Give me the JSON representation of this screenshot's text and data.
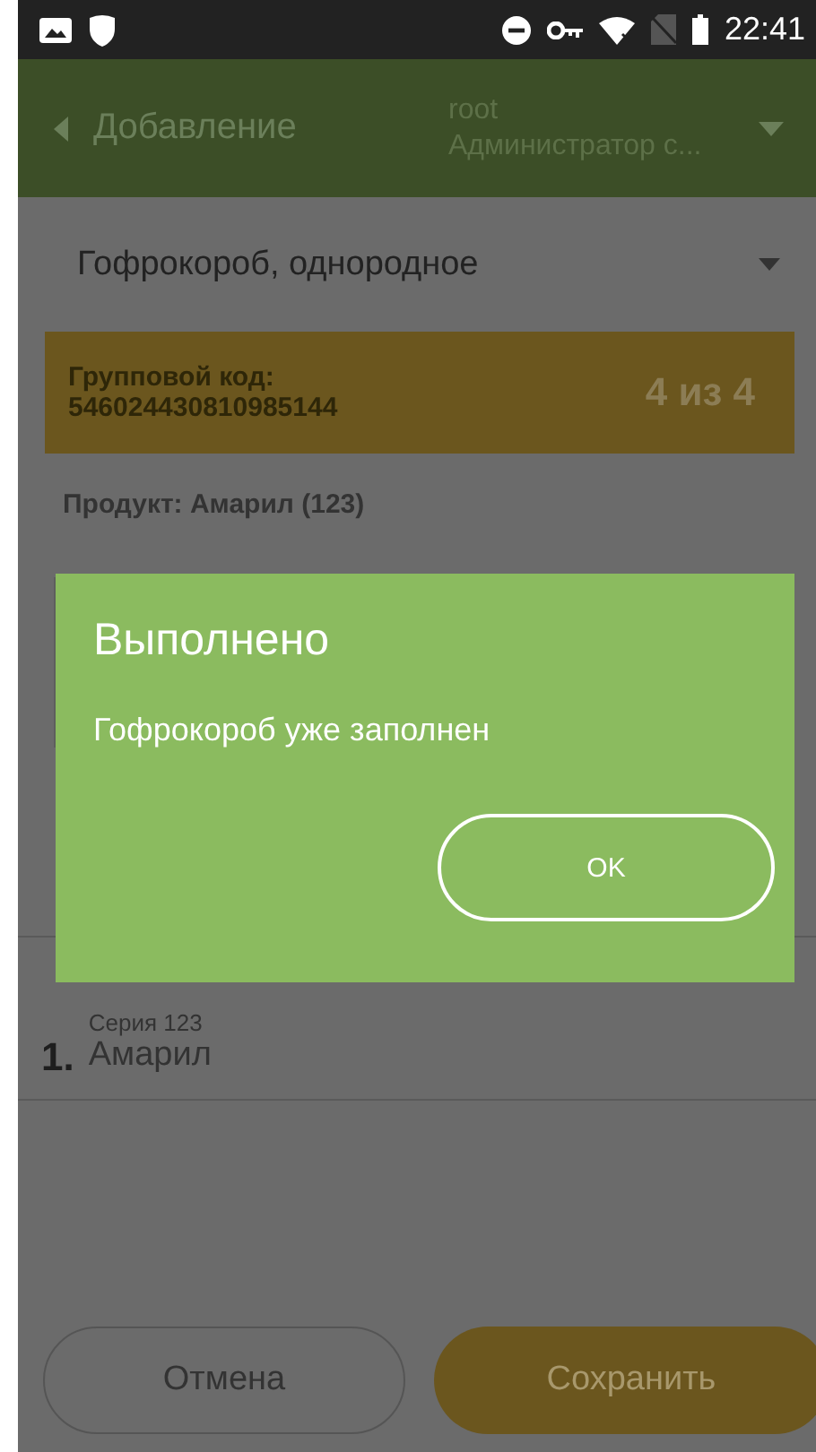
{
  "status_bar": {
    "time": "22:41"
  },
  "app_bar": {
    "back_label": "Добавление",
    "user": "root",
    "role": "Администратор с..."
  },
  "package_type": {
    "value": "Гофрокороб, однородное"
  },
  "group_code": {
    "label": "Групповой код:",
    "code": "546024430810985144",
    "count": "4 из 4"
  },
  "product": "Продукт: Амарил (123)",
  "items": [
    {
      "number": "1.",
      "series": "Серия 123",
      "name": "Амарил"
    }
  ],
  "dialog": {
    "title": "Выполнено",
    "message": "Гофрокороб уже заполнен",
    "button": "OK"
  },
  "buttons": {
    "cancel": "Отмена",
    "save": "Сохранить"
  }
}
